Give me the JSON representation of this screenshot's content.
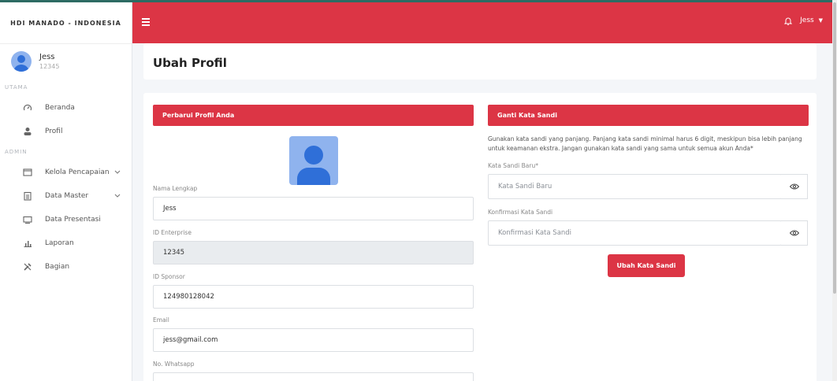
{
  "sidebar": {
    "brand": "HDI MANADO - INDONESIA",
    "user": {
      "name": "Jess",
      "id": "12345"
    },
    "sections": {
      "main": "UTAMA",
      "admin": "ADMIN"
    },
    "items": [
      {
        "label": "Beranda",
        "icon": "gauge-icon"
      },
      {
        "label": "Profil",
        "icon": "user-icon"
      },
      {
        "label": "Kelola Pencapaian",
        "icon": "window-icon"
      },
      {
        "label": "Data Master",
        "icon": "clipboard-icon"
      },
      {
        "label": "Data Presentasi",
        "icon": "monitor-icon"
      },
      {
        "label": "Laporan",
        "icon": "bar-chart-icon"
      },
      {
        "label": "Bagian",
        "icon": "tools-icon"
      }
    ]
  },
  "topbar": {
    "user_label": "Jess",
    "brand_color": "#dc3545"
  },
  "page": {
    "title": "Ubah Profil"
  },
  "profile": {
    "header": "Perbarui Profil Anda",
    "fields": {
      "name_label": "Nama Lengkap",
      "name_value": "Jess",
      "enterprise_label": "ID Enterprise",
      "enterprise_value": "12345",
      "sponsor_label": "ID Sponsor",
      "sponsor_value": "124980128042",
      "email_label": "Email",
      "email_value": "jess@gmail.com",
      "whatsapp_label": "No. Whatsapp"
    }
  },
  "password": {
    "header": "Ganti Kata Sandi",
    "description": "Gunakan kata sandi yang panjang. Panjang kata sandi minimal harus 6 digit, meskipun bisa lebih panjang untuk keamanan ekstra. Jangan gunakan kata sandi yang sama untuk semua akun Anda*",
    "new_label": "Kata Sandi Baru*",
    "new_placeholder": "Kata Sandi Baru",
    "confirm_label": "Konfirmasi Kata Sandi",
    "confirm_placeholder": "Konfirmasi Kata Sandi",
    "submit_label": "Ubah Kata Sandi"
  }
}
